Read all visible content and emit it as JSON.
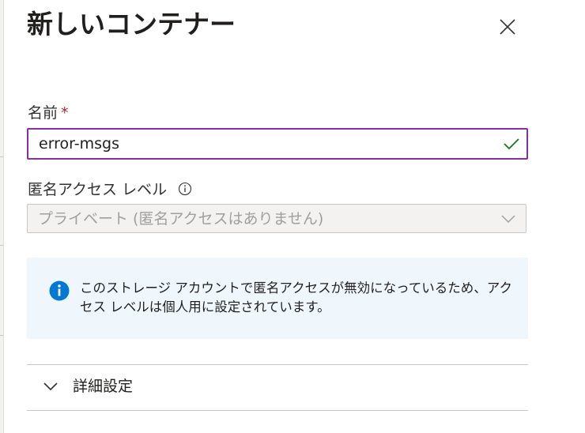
{
  "panel": {
    "title": "新しいコンテナー",
    "close_label": "close"
  },
  "name_field": {
    "label": "名前",
    "required_marker": "*",
    "value": "error-msgs",
    "valid": true
  },
  "access_level": {
    "label": "匿名アクセス レベル",
    "selected": "プライベート (匿名アクセスはありません)",
    "disabled": true
  },
  "info_message": {
    "text": "このストレージ アカウントで匿名アクセスが無効になっているため、アクセス レベルは個人用に設定されています。"
  },
  "advanced": {
    "label": "詳細設定",
    "expanded": false
  },
  "colors": {
    "focus_border": "#8a2da5",
    "valid_check": "#107c10",
    "info_icon": "#0078d4",
    "info_background": "#eff6fc",
    "required_star": "#a4262c"
  },
  "icons": {
    "close": "close-icon",
    "valid": "checkmark-icon",
    "help": "info-circle-icon",
    "dropdown": "chevron-down-icon",
    "info": "info-filled-icon",
    "expander": "chevron-down-icon"
  }
}
